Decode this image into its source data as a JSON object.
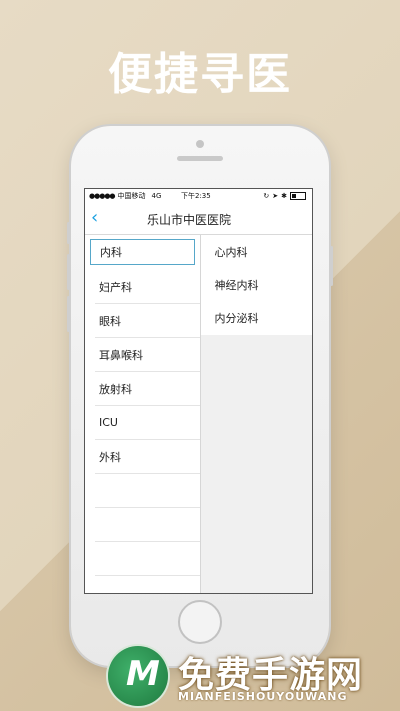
{
  "headline": "便捷寻医",
  "status_bar": {
    "signal": "●●●●●",
    "carrier": "中国移动",
    "network": "4G",
    "time": "下午2:35",
    "icons": [
      "rotation-lock-icon",
      "location-icon",
      "bluetooth-icon",
      "battery-icon"
    ]
  },
  "nav": {
    "back_icon": "back-chevron-icon",
    "title": "乐山市中医医院"
  },
  "departments": [
    "内科",
    "妇产科",
    "眼科",
    "耳鼻喉科",
    "放射科",
    "ICU",
    "外科"
  ],
  "selected_department": "内科",
  "sub_departments": [
    "心内科",
    "神经内科",
    "内分泌科"
  ],
  "watermark": {
    "logo_letter": "M",
    "title": "免费手游网",
    "subtitle": "MIANFEISHOUYOUWANG"
  },
  "colors": {
    "accent": "#1aa0e0",
    "selected_border": "#56a7c9",
    "background": "#d6c4a5"
  }
}
